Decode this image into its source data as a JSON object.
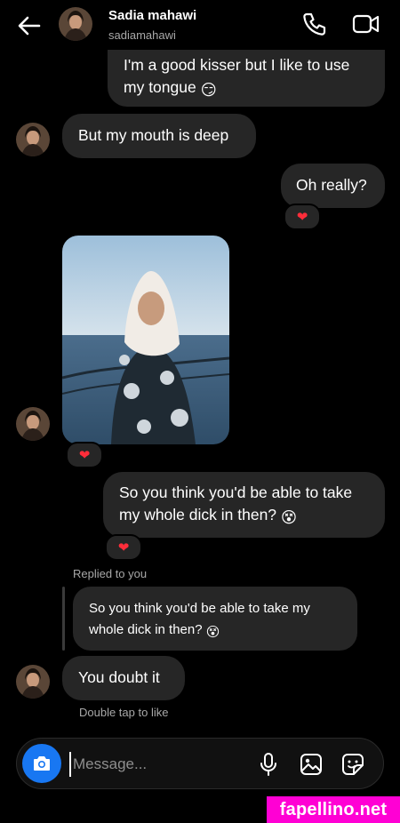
{
  "header": {
    "name": "Sadia mahawi",
    "username": "sadiamahawi",
    "back_icon": "arrow-left-icon",
    "call_icon": "phone-icon",
    "video_icon": "video-camera-icon"
  },
  "messages": [
    {
      "from": "me",
      "text": "I'm a good kisser but I like to use my tongue",
      "emoji": "😏"
    },
    {
      "from": "them",
      "text": "But my mouth is deep"
    },
    {
      "from": "me",
      "text": "Oh really?",
      "reaction": "❤"
    },
    {
      "from": "them",
      "type": "photo",
      "reaction": "❤"
    },
    {
      "from": "me",
      "text": "So you think you'd be able to take my whole dick in then?",
      "emoji": "😵",
      "reaction": "❤"
    }
  ],
  "reply": {
    "label": "Replied to you",
    "quoted_text": "So you think you'd be able to take my whole dick in then?",
    "quoted_emoji": "😵",
    "text": "You doubt it",
    "hint": "Double tap to like"
  },
  "composer": {
    "placeholder": "Message...",
    "icons": [
      "camera-icon",
      "microphone-icon",
      "gallery-icon",
      "sticker-icon"
    ]
  },
  "watermark": "fapellino.net",
  "colors": {
    "background": "#000000",
    "bubble": "#262626",
    "accent": "#1877f2",
    "heart": "#ff2d3a",
    "watermark_bg": "#ff00d4"
  }
}
